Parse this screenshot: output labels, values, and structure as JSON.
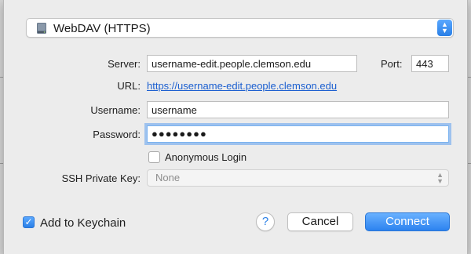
{
  "protocol": {
    "selected": "WebDAV (HTTPS)",
    "icon": "drive-icon"
  },
  "form": {
    "server_label": "Server:",
    "server_value": "username-edit.people.clemson.edu",
    "port_label": "Port:",
    "port_value": "443",
    "url_label": "URL:",
    "url_value": "https://username-edit.people.clemson.edu",
    "username_label": "Username:",
    "username_value": "username",
    "password_label": "Password:",
    "password_value": "●●●●●●●●",
    "anonymous_label": "Anonymous Login",
    "ssh_label": "SSH Private Key:",
    "ssh_value": "None"
  },
  "footer": {
    "keychain_label": "Add to Keychain",
    "help_label": "?",
    "cancel_label": "Cancel",
    "connect_label": "Connect"
  },
  "colors": {
    "accent": "#2a7fe6",
    "link": "#1b5fd0",
    "background": "#ececec"
  }
}
